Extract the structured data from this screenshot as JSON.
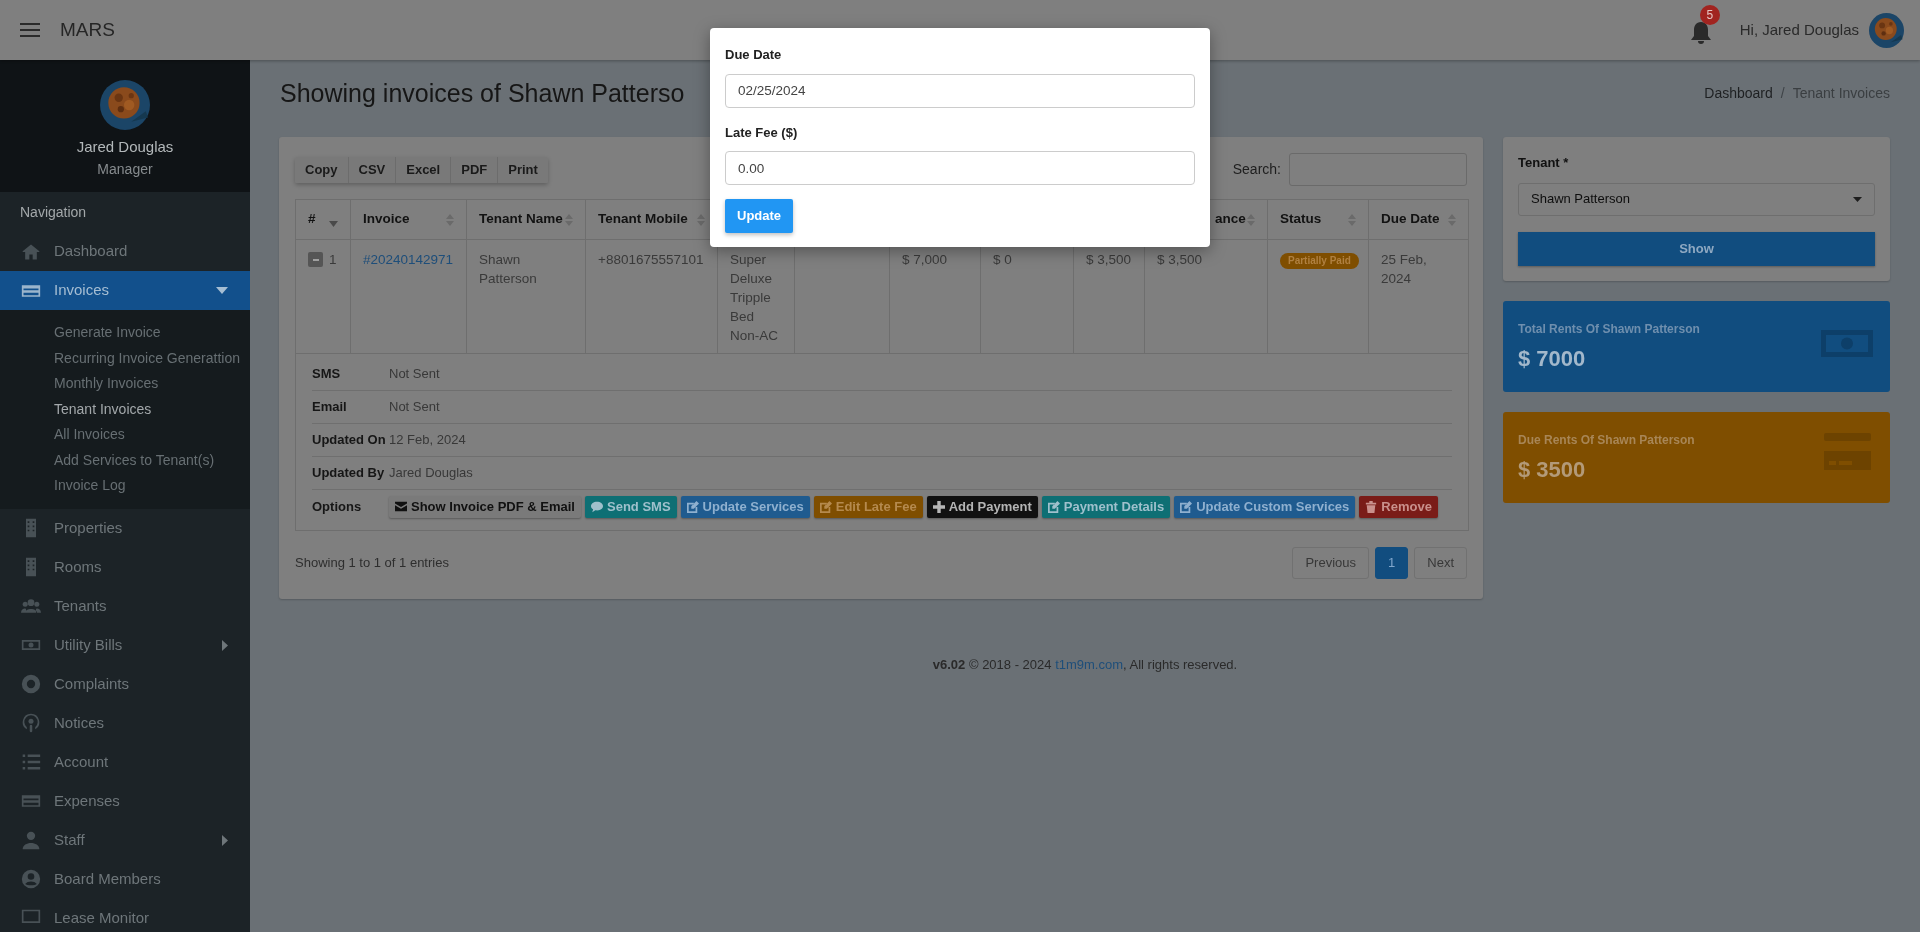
{
  "header": {
    "app_title": "MARS",
    "notifications": "5",
    "greeting": "Hi, Jared Douglas"
  },
  "profile": {
    "name": "Jared Douglas",
    "role": "Manager"
  },
  "sidebar": {
    "heading": "Navigation",
    "items": [
      {
        "label": "Dashboard",
        "kind": "link",
        "selected": false
      },
      {
        "label": "Invoices",
        "kind": "menu",
        "selected": true,
        "expanded": true,
        "children": [
          {
            "label": "Generate Invoice",
            "selected": false
          },
          {
            "label": "Recurring Invoice Generattion",
            "selected": false
          },
          {
            "label": "Monthly Invoices",
            "selected": false
          },
          {
            "label": "Tenant Invoices",
            "selected": true
          },
          {
            "label": "All Invoices",
            "selected": false
          },
          {
            "label": "Add Services to Tenant(s)",
            "selected": false
          },
          {
            "label": "Invoice Log",
            "selected": false
          }
        ]
      },
      {
        "label": "Properties",
        "kind": "link",
        "selected": false
      },
      {
        "label": "Rooms",
        "kind": "link",
        "selected": false
      },
      {
        "label": "Tenants",
        "kind": "link",
        "selected": false
      },
      {
        "label": "Utility Bills",
        "kind": "menu",
        "selected": false,
        "expanded": false
      },
      {
        "label": "Complaints",
        "kind": "link",
        "selected": false
      },
      {
        "label": "Notices",
        "kind": "link",
        "selected": false
      },
      {
        "label": "Account",
        "kind": "link",
        "selected": false
      },
      {
        "label": "Expenses",
        "kind": "link",
        "selected": false
      },
      {
        "label": "Staff",
        "kind": "menu",
        "selected": false,
        "expanded": false
      },
      {
        "label": "Board Members",
        "kind": "link",
        "selected": false
      },
      {
        "label": "Lease Monitor",
        "kind": "link",
        "selected": false
      }
    ]
  },
  "page": {
    "title": "Showing invoices of Shawn Patterso",
    "breadcrumb": [
      "Dashboard",
      "Tenant Invoices"
    ],
    "breadcrumb_separator": "/"
  },
  "table": {
    "export_buttons": [
      "Copy",
      "CSV",
      "Excel",
      "PDF",
      "Print"
    ],
    "search_label": "Search:",
    "columns": [
      {
        "label": "#",
        "sorted": true
      },
      {
        "label": "Invoice",
        "sorted": false
      },
      {
        "label": "Tenant Name",
        "sorted": false
      },
      {
        "label": "Tenant Mobile",
        "sorted": false
      },
      null,
      null,
      null,
      null,
      null,
      {
        "label": "ance",
        "sorted": false
      },
      {
        "label": "Status",
        "sorted": false
      },
      {
        "label": "Due Date",
        "sorted": false
      }
    ],
    "rows": [
      {
        "expanded": true,
        "cells": [
          "1",
          {
            "link": "#20240142971"
          },
          "Shawn Patterson",
          "+8801675557101",
          "Super Deluxe Tripple Bed Non-AC",
          null,
          "$ 7,000",
          "$ 0",
          "$ 3,500",
          "$ 3,500",
          {
            "badge": "Partially Paid",
            "color": "#7f4e00"
          },
          "25 Feb, 2024"
        ],
        "details": [
          {
            "label": "SMS",
            "value": "Not Sent"
          },
          {
            "label": "Email",
            "value": "Not Sent"
          },
          {
            "label": "Updated On",
            "value": "12 Feb, 2024"
          },
          {
            "label": "Updated By",
            "value": "Jared Douglas"
          }
        ],
        "options_label": "Options",
        "options": [
          {
            "label": "Show Invoice PDF & Email",
            "kind": "email",
            "color": "#7a7a7a"
          },
          {
            "label": "Send SMS",
            "kind": "sms",
            "color": "#0e6f74"
          },
          {
            "label": "Update Services",
            "kind": "edit",
            "color": "#1f5b8f"
          },
          {
            "label": "Edit Late Fee",
            "kind": "edit",
            "color": "#7f4e00"
          },
          {
            "label": "Add Payment",
            "kind": "add",
            "color": "#111111"
          },
          {
            "label": "Payment Details",
            "kind": "edit",
            "color": "#0e6f74"
          },
          {
            "label": "Update Custom Services",
            "kind": "edit",
            "color": "#1f5b8f"
          },
          {
            "label": "Remove",
            "kind": "delete",
            "color": "#7a1c18"
          }
        ]
      }
    ],
    "info": "Showing 1 to 1 of 1 entries",
    "pagination": [
      {
        "label": "Previous",
        "selected": false
      },
      {
        "label": "1",
        "selected": true
      },
      {
        "label": "Next",
        "selected": false
      }
    ]
  },
  "tenant_form": {
    "label": "Tenant *",
    "value": "Shawn Patterson",
    "button": "Show"
  },
  "stats": [
    {
      "title": "Total Rents Of Shawn Patterson",
      "value": "$ 7000",
      "color": "#114d7f",
      "kind": "money"
    },
    {
      "title": "Due Rents Of Shawn Patterson",
      "value": "$ 3500",
      "color": "#7f4e00",
      "kind": "card"
    }
  ],
  "footer": {
    "version": "v6.02",
    "text": "© 2018 - 2024",
    "link": "t1m9m.com",
    "suffix": ", All rights reserved."
  },
  "dialog": {
    "fields": [
      {
        "label": "Due Date",
        "value": "02/25/2024"
      },
      {
        "label": "Late Fee ($)",
        "value": "0.00"
      }
    ],
    "button": "Update"
  }
}
